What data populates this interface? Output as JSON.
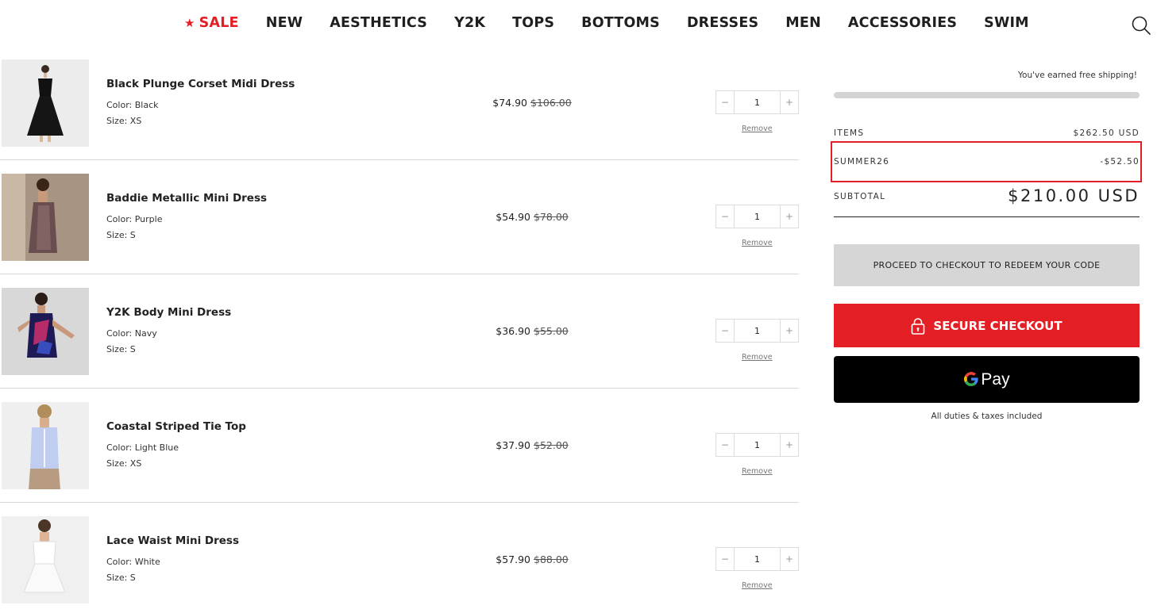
{
  "nav": {
    "items": [
      {
        "label": "SALE",
        "star": "★",
        "accent": "#e31e24"
      },
      {
        "label": "NEW"
      },
      {
        "label": "AESTHETICS"
      },
      {
        "label": "Y2K"
      },
      {
        "label": "TOPS"
      },
      {
        "label": "BOTTOMS"
      },
      {
        "label": "DRESSES"
      },
      {
        "label": "MEN"
      },
      {
        "label": "ACCESSORIES"
      },
      {
        "label": "SWIM"
      }
    ],
    "search_icon": "search-icon"
  },
  "cart": {
    "remove_label": "Remove",
    "items": [
      {
        "title": "Black Plunge Corset Midi Dress",
        "color": "Color: Black",
        "size": "Size: XS",
        "price": "$74.90",
        "was": "$106.00",
        "qty": "1"
      },
      {
        "title": "Baddie Metallic Mini Dress",
        "color": "Color: Purple",
        "size": "Size: S",
        "price": "$54.90",
        "was": "$78.00",
        "qty": "1"
      },
      {
        "title": "Y2K Body Mini Dress",
        "color": "Color: Navy",
        "size": "Size: S",
        "price": "$36.90",
        "was": "$55.00",
        "qty": "1"
      },
      {
        "title": "Coastal Striped Tie Top",
        "color": "Color: Light Blue",
        "size": "Size: XS",
        "price": "$37.90",
        "was": "$52.00",
        "qty": "1"
      },
      {
        "title": "Lace Waist Mini Dress",
        "color": "Color: White",
        "size": "Size: S",
        "price": "$57.90",
        "was": "$88.00",
        "qty": "1"
      }
    ]
  },
  "summary": {
    "free_shipping": "You've earned free shipping!",
    "progress_fraction": 1.0,
    "items_label": "ITEMS",
    "items_value": "$262.50 USD",
    "code_label": "SUMMER26",
    "code_value": "-$52.50",
    "subtotal_label": "SUBTOTAL",
    "subtotal_value": "$210.00 USD",
    "redeem_label": "PROCEED TO CHECKOUT TO REDEEM YOUR CODE",
    "checkout_label": "SECURE CHECKOUT",
    "gpay_g": "G",
    "gpay_label": "Pay",
    "duties": "All duties & taxes included"
  },
  "colors": {
    "accent_red": "#e31e24",
    "gpay_bg": "#000000",
    "redeem_bg": "#d6d6d6"
  }
}
